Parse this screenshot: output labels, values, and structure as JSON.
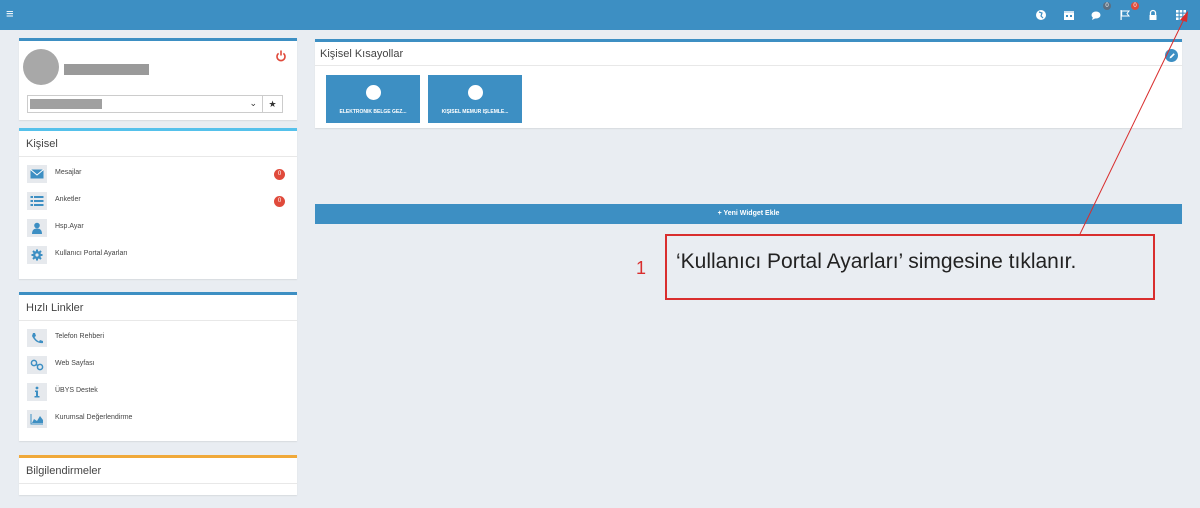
{
  "topbar": {
    "menu_icon": "hamburger-icon",
    "icons": [
      {
        "name": "globe-icon",
        "badge": ""
      },
      {
        "name": "calendar-icon",
        "badge": ""
      },
      {
        "name": "chat-icon",
        "badge": "0"
      },
      {
        "name": "flag-icon",
        "badge": "0"
      },
      {
        "name": "lock-icon",
        "badge": ""
      },
      {
        "name": "grid-icon",
        "badge": ""
      }
    ],
    "colors": {
      "bar": "#3d8fc3",
      "badge_chat": "#3d8fc3",
      "badge_flag": "#e04a3b"
    }
  },
  "profile": {
    "power_icon": "power-icon",
    "favorite_icon": "star-icon"
  },
  "kisisel": {
    "title": "Kişisel",
    "items": [
      {
        "label": "Mesajlar",
        "icon": "envelope-icon",
        "badge": "0"
      },
      {
        "label": "Anketler",
        "icon": "list-icon",
        "badge": "0"
      },
      {
        "label": "Hsp.Ayar",
        "icon": "user-icon",
        "badge": ""
      },
      {
        "label": "Kullanıcı Portal Ayarları",
        "icon": "gear-icon",
        "badge": ""
      }
    ]
  },
  "hizli": {
    "title": "Hızlı Linkler",
    "items": [
      {
        "label": "Telefon Rehberi",
        "icon": "phone-icon"
      },
      {
        "label": "Web Sayfası",
        "icon": "link-icon"
      },
      {
        "label": "ÜBYS Destek",
        "icon": "info-icon"
      },
      {
        "label": "Kurumsal Değerlendirme",
        "icon": "area-chart-icon"
      }
    ]
  },
  "bilgi": {
    "title": "Bilgilendirmeler"
  },
  "shortcuts": {
    "title": "Kişisel Kısayollar",
    "tiles": [
      {
        "label": "ELEKTRONİK BELGE GEZ..."
      },
      {
        "label": "KİŞİSEL MEMUR İŞLEMLE..."
      }
    ]
  },
  "add_widget": {
    "label": "+ Yeni Widget Ekle"
  },
  "annotation": {
    "number": "1",
    "text": "‘Kullanıcı Portal Ayarları’ simgesine tıklanır."
  }
}
